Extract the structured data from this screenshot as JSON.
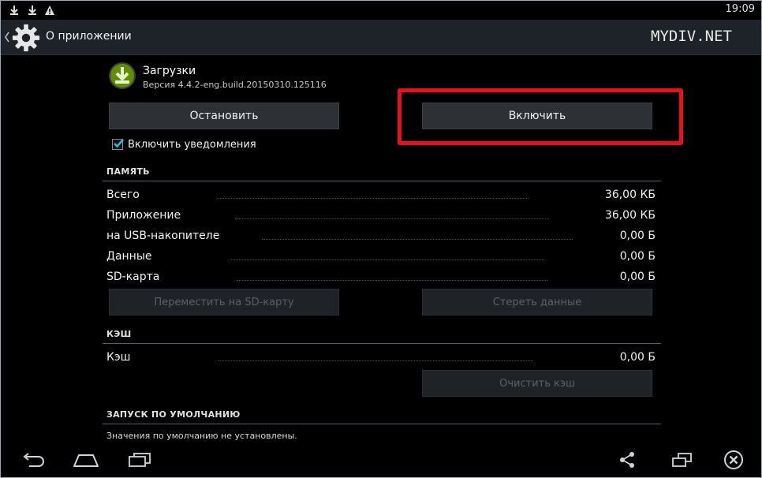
{
  "status_bar": {
    "time": "19:09",
    "icons": [
      "download-icon",
      "download-icon",
      "warning-icon"
    ]
  },
  "action_bar": {
    "title": "О приложении",
    "icon": "gear-icon"
  },
  "watermark": "MYDIV.NET",
  "app": {
    "name": "Загрузки",
    "version": "Версия 4.4.2-eng.build.20150310.125116",
    "icon": "download-icon",
    "accent": "#7fb800"
  },
  "buttons": {
    "stop": "Остановить",
    "enable": "Включить",
    "move_sd": "Переместить на SD-карту",
    "clear_data": "Стереть данные",
    "clear_cache": "Очистить кэш"
  },
  "notifications": {
    "label": "Включить уведомления",
    "checked": true
  },
  "memory": {
    "header": "ПАМЯТЬ",
    "rows": [
      {
        "label": "Всего",
        "value": "36,00 КБ"
      },
      {
        "label": "Приложение",
        "value": "36,00 КБ"
      },
      {
        "label": "на USB-накопителе",
        "value": "0,00 Б"
      },
      {
        "label": "Данные",
        "value": "0,00 Б"
      },
      {
        "label": "SD-карта",
        "value": "0,00 Б"
      }
    ]
  },
  "cache": {
    "header": "КЭШ",
    "rows": [
      {
        "label": "Кэш",
        "value": "0,00 Б"
      }
    ]
  },
  "defaults": {
    "header": "ЗАПУСК ПО УМОЛЧАНИЮ",
    "note": "Значения по умолчанию не установлены."
  },
  "nav_bar": {
    "icons": [
      "back-icon",
      "home-icon",
      "recent-apps-icon",
      "share-icon",
      "window-icon",
      "close-icon"
    ]
  },
  "colors": {
    "highlight": "#e8101c",
    "checkbox": "#33b5e5"
  }
}
